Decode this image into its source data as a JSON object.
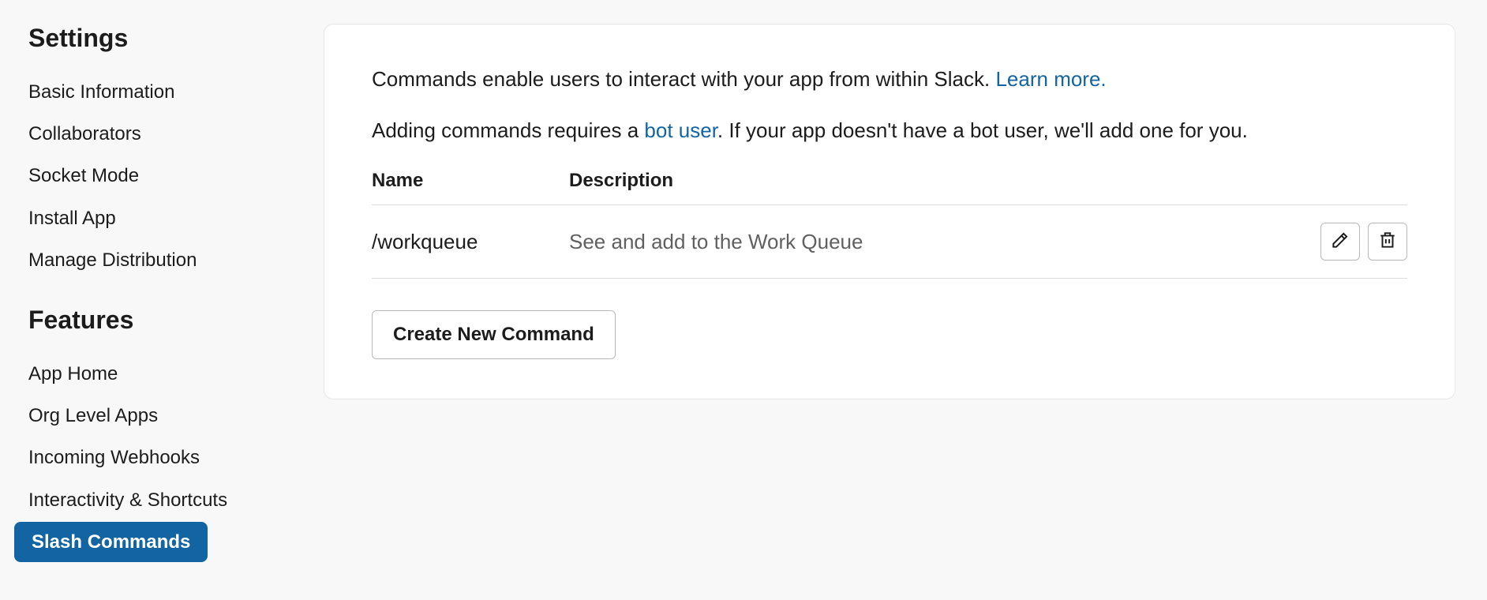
{
  "sidebar": {
    "sections": [
      {
        "title": "Settings",
        "items": [
          {
            "label": "Basic Information",
            "active": false
          },
          {
            "label": "Collaborators",
            "active": false
          },
          {
            "label": "Socket Mode",
            "active": false
          },
          {
            "label": "Install App",
            "active": false
          },
          {
            "label": "Manage Distribution",
            "active": false
          }
        ]
      },
      {
        "title": "Features",
        "items": [
          {
            "label": "App Home",
            "active": false
          },
          {
            "label": "Org Level Apps",
            "active": false
          },
          {
            "label": "Incoming Webhooks",
            "active": false
          },
          {
            "label": "Interactivity & Shortcuts",
            "active": false
          },
          {
            "label": "Slash Commands",
            "active": true
          }
        ]
      }
    ]
  },
  "main": {
    "intro1_pre": "Commands enable users to interact with your app from within Slack. ",
    "intro1_link": "Learn more.",
    "intro2_pre": "Adding commands requires a ",
    "intro2_link": "bot user",
    "intro2_post": ". If your app doesn't have a bot user, we'll add one for you.",
    "table": {
      "headers": {
        "name": "Name",
        "description": "Description"
      },
      "rows": [
        {
          "name": "/workqueue",
          "description": "See and add to the Work Queue"
        }
      ]
    },
    "create_button": "Create New Command"
  }
}
